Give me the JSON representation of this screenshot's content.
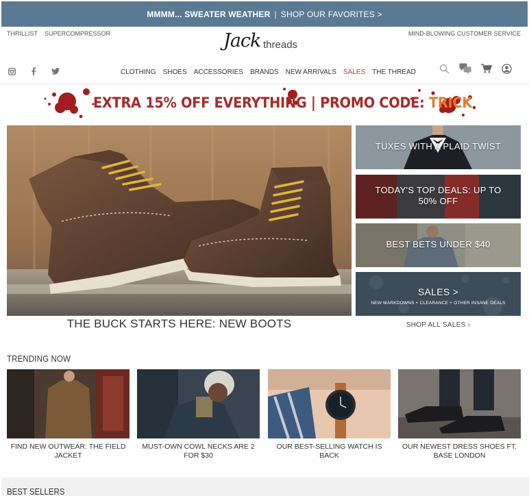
{
  "topbar": {
    "bold": "MMMM... SWEATER WEATHER",
    "separator": "|",
    "link": "SHOP OUR FAVORITES >"
  },
  "utility": {
    "left": [
      "THRILLIST",
      "SUPERCOMPRESSOR"
    ],
    "right": "MIND-BLOWING CUSTOMER SERVICE"
  },
  "logo": {
    "part1": "Jack",
    "part2": "threads"
  },
  "social": [
    "instagram-icon",
    "facebook-icon",
    "twitter-icon"
  ],
  "nav": {
    "items": [
      "CLOTHING",
      "SHOES",
      "ACCESSORIES",
      "BRANDS",
      "NEW ARRIVALS",
      "SALES",
      "THE THREAD"
    ],
    "sales_color": "#c0392b"
  },
  "tools": [
    "search-icon",
    "chat-icon",
    "cart-icon",
    "account-icon"
  ],
  "promo": {
    "text": "EXTRA 15% OFF EVERYTHING | PROMO CODE: ",
    "code": "TRICK",
    "text_color": "#a82a2a",
    "code_color": "#e8792b"
  },
  "hero": {
    "caption": "THE BUCK STARTS HERE: NEW BOOTS"
  },
  "tiles": [
    {
      "title": "TUXES WITH A PLAID TWIST"
    },
    {
      "title_line1": "TODAY'S TOP DEALS: UP TO",
      "title_line2": "50% OFF"
    },
    {
      "title": "BEST BETS UNDER $40"
    },
    {
      "title": "SALES >",
      "subtitle": "NEW MARKDOWNS + CLEARANCE + OTHER INSANE DEALS"
    }
  ],
  "shop_all": "SHOP ALL SALES  ›",
  "trending": {
    "title": "TRENDING NOW",
    "cards": [
      {
        "line1": "FIND NEW OUTWEAR: THE FIELD",
        "line2": "JACKET"
      },
      {
        "line1": "MUST-OWN COWL NECKS ARE 2",
        "line2": "FOR $30"
      },
      {
        "line1": "OUR BEST-SELLING WATCH IS",
        "line2": "BACK"
      },
      {
        "line1": "OUR NEWEST DRESS SHOES FT.",
        "line2": "BASE LONDON"
      }
    ]
  },
  "bestsellers": {
    "title": "BEST SELLERS"
  },
  "colors": {
    "topbar": "#5a7a94",
    "accent_red": "#a82a2a",
    "accent_orange": "#e8792b"
  }
}
